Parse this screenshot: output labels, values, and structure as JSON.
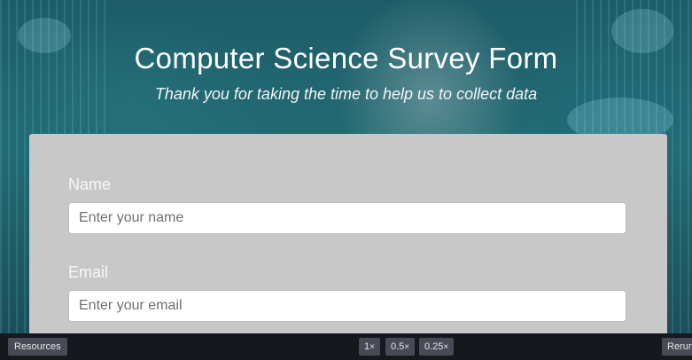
{
  "hero": {
    "title": "Computer Science Survey Form",
    "subtitle": "Thank you for taking the time to help us to collect data"
  },
  "form": {
    "name_label": "Name",
    "name_placeholder": "Enter your name",
    "email_label": "Email",
    "email_placeholder": "Enter your email"
  },
  "toolbar": {
    "resources_label": "Resources",
    "zoom_options": [
      {
        "value": "1",
        "suffix": "×"
      },
      {
        "value": "0.5",
        "suffix": "×"
      },
      {
        "value": "0.25",
        "suffix": "×"
      }
    ],
    "rerun_label": "Rerun"
  },
  "colors": {
    "hero_overlay": "#236b74",
    "form_background": "#c8c8c8",
    "toolbar_background": "#17181d",
    "toolbar_button": "#474b55"
  }
}
